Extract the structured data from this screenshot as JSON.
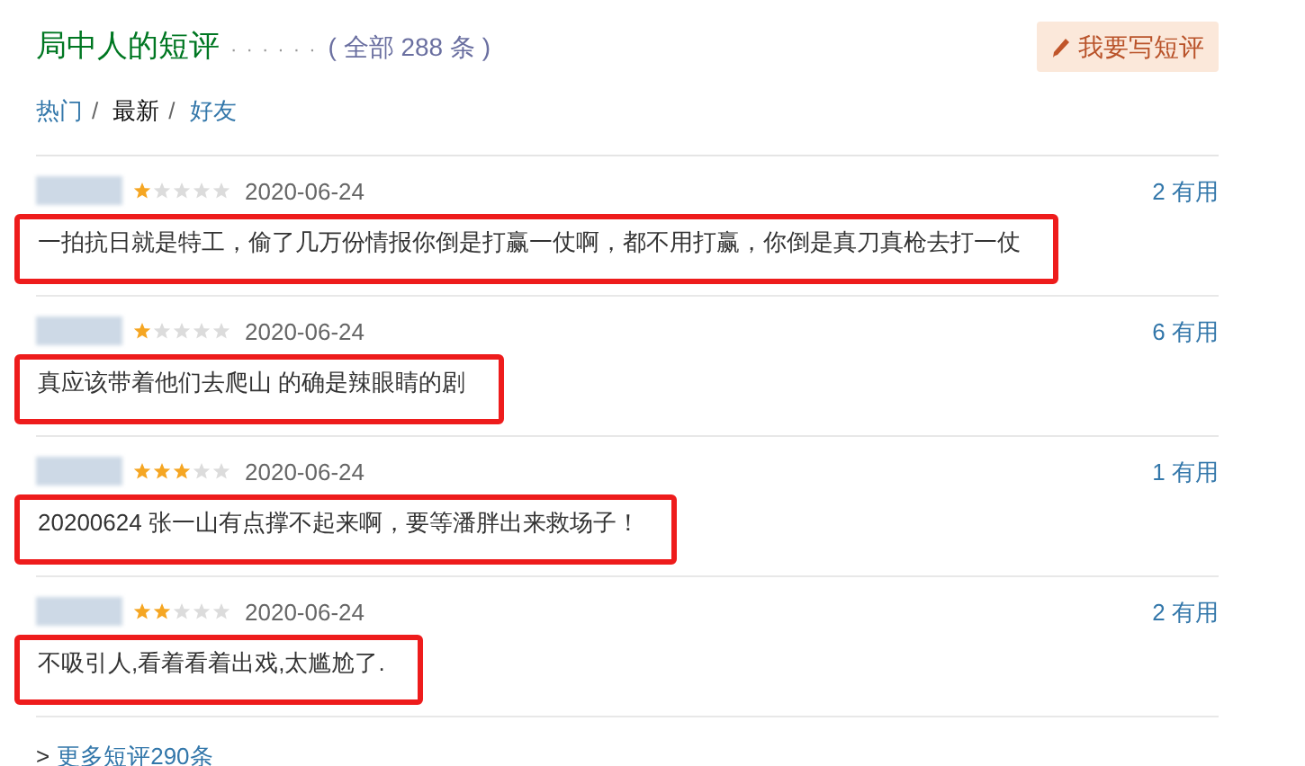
{
  "header": {
    "title": "局中人的短评",
    "dots": "· · · · · ·",
    "count": "( 全部 288 条 )",
    "write_button": "我要写短评"
  },
  "tabs": [
    {
      "label": "热门",
      "selected": false,
      "separator": "/"
    },
    {
      "label": "最新",
      "selected": true,
      "separator": "/"
    },
    {
      "label": "好友",
      "selected": false
    }
  ],
  "comments": [
    {
      "stars": 1,
      "date": "2020-06-24",
      "useful": "2 有用",
      "text": "一拍抗日就是特工，偷了几万份情报你倒是打赢一仗啊，都不用打赢，你倒是真刀真枪去打一仗",
      "highlighted": true
    },
    {
      "stars": 1,
      "date": "2020-06-24",
      "useful": "6 有用",
      "text": "真应该带着他们去爬山 的确是辣眼睛的剧",
      "highlighted": true
    },
    {
      "stars": 3,
      "date": "2020-06-24",
      "useful": "1 有用",
      "text": "20200624 张一山有点撑不起来啊，要等潘胖出来救场子！",
      "highlighted": true
    },
    {
      "stars": 2,
      "date": "2020-06-24",
      "useful": "2 有用",
      "text": "不吸引人,看着看着出戏,太尴尬了.",
      "highlighted": true
    }
  ],
  "more": {
    "arrow": ">",
    "label": "更多短评290条"
  }
}
